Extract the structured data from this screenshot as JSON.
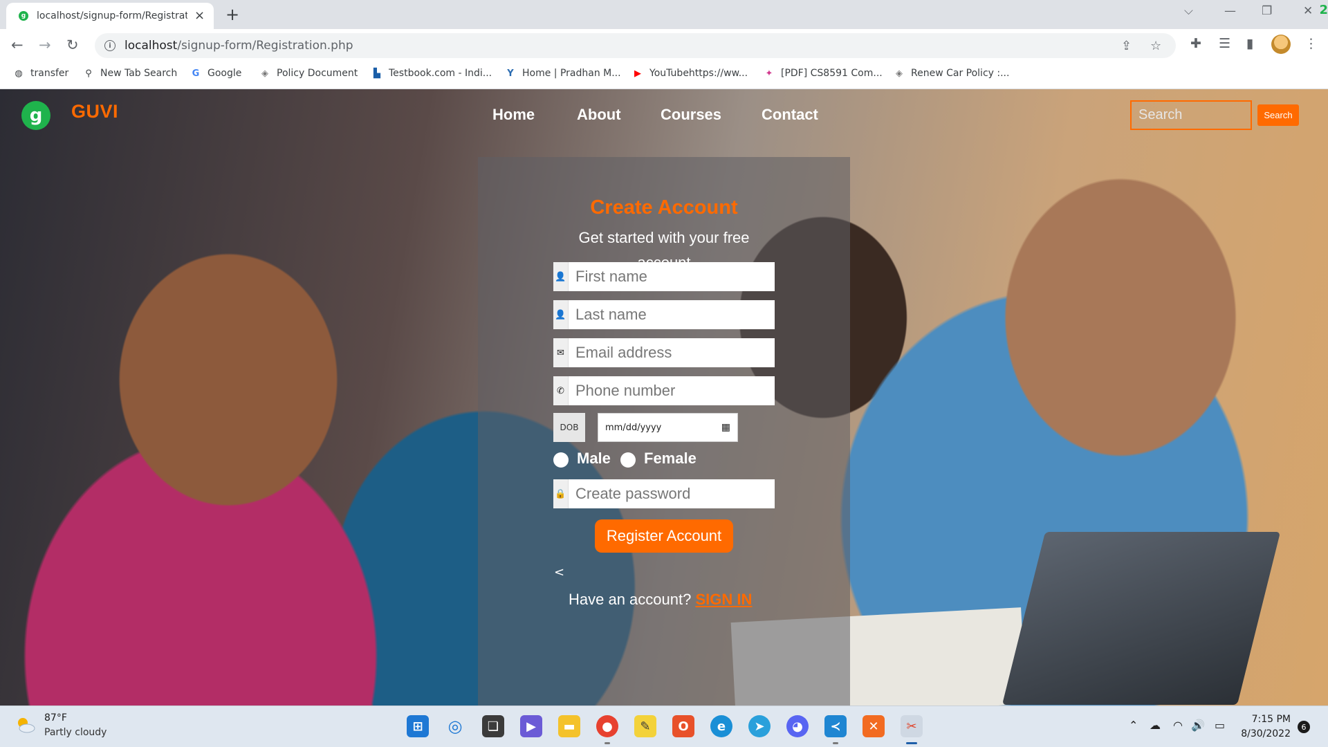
{
  "browser": {
    "tab_title": "localhost/signup-form/Registration.php",
    "tab_favicon": "guvi-favicon",
    "url_host": "localhost",
    "url_path": "/signup-form/Registration.php",
    "window_badge": "2",
    "bookmarks": [
      {
        "label": "transfer",
        "icon": "globe-icon"
      },
      {
        "label": "New Tab Search",
        "icon": "search-icon"
      },
      {
        "label": "Google",
        "icon": "google-icon"
      },
      {
        "label": "Policy Document",
        "icon": "dropbox-icon"
      },
      {
        "label": "Testbook.com - Indi...",
        "icon": "testbook-icon"
      },
      {
        "label": "Home | Pradhan M...",
        "icon": "pradhan-icon"
      },
      {
        "label": "YouTubehttps://ww...",
        "icon": "youtube-icon"
      },
      {
        "label": "[PDF] CS8591 Com...",
        "icon": "pdf-icon"
      },
      {
        "label": "Renew Car Policy :...",
        "icon": "dropbox-icon"
      }
    ]
  },
  "site": {
    "brand": "GUVI",
    "logo_letter": "g",
    "nav": [
      "Home",
      "About",
      "Courses",
      "Contact"
    ],
    "search_placeholder": "Search",
    "search_button": "Search"
  },
  "form": {
    "title": "Create Account",
    "subtitle": "Get started with your free account",
    "first_name_placeholder": "First name",
    "last_name_placeholder": "Last name",
    "email_placeholder": "Email address",
    "phone_placeholder": "Phone number",
    "dob_label": "DOB",
    "dob_placeholder": "mm/dd/yyyy",
    "gender_options": [
      "Male",
      "Female"
    ],
    "password_placeholder": "Create password",
    "submit_label": "Register Account",
    "back_glyph": "<",
    "have_account_text": "Have an account?",
    "signin_link": "SIGN IN"
  },
  "taskbar": {
    "weather_temp": "87°F",
    "weather_condition": "Partly cloudy",
    "time": "7:15 PM",
    "date": "8/30/2022",
    "notification_count": "6",
    "apps": [
      "windows-start-icon",
      "search-icon",
      "task-view-icon",
      "teams-icon",
      "file-explorer-icon",
      "chrome-icon",
      "sticky-notes-icon",
      "office-icon",
      "edge-icon",
      "telegram-icon",
      "discord-icon",
      "vscode-icon",
      "xampp-icon",
      "snipping-tool-icon"
    ]
  },
  "colors": {
    "accent": "#ff6a00",
    "guvi_green": "#1fb34c",
    "chrome_tabstrip": "#dee1e6"
  }
}
